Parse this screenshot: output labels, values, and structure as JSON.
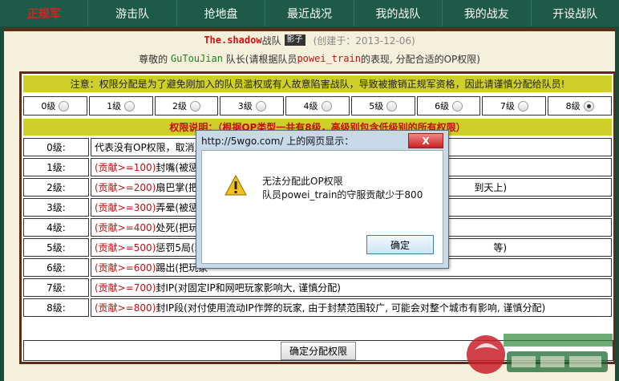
{
  "nav": {
    "items": [
      {
        "label": "正规军",
        "active": true
      },
      {
        "label": "游击队",
        "active": false
      },
      {
        "label": "抢地盘",
        "active": false
      },
      {
        "label": "最近战况",
        "active": false
      },
      {
        "label": "我的战队",
        "active": false
      },
      {
        "label": "我的战友",
        "active": false
      },
      {
        "label": "开设战队",
        "active": false
      }
    ]
  },
  "team": {
    "name": "The.shadow",
    "suffix": "战队",
    "logo_text": "影子",
    "created": "(创建于：2013-12-06)"
  },
  "subline": {
    "prefix": "尊敬的",
    "leader": "GuTouJian",
    "role": "队长(请根据队员",
    "member": "powei_train",
    "suffix": "的表现, 分配合适的OP权限)"
  },
  "notice": "注意：权限分配是为了避免刚加入的队员滥权或有人故意陷害战队，导致被撤销正规军资格，因此请谨慎分配给队员!",
  "levels": [
    {
      "label": "0级",
      "selected": false
    },
    {
      "label": "1级",
      "selected": false
    },
    {
      "label": "2级",
      "selected": false
    },
    {
      "label": "3级",
      "selected": false
    },
    {
      "label": "4级",
      "selected": false
    },
    {
      "label": "5级",
      "selected": false
    },
    {
      "label": "6级",
      "selected": false
    },
    {
      "label": "7级",
      "selected": false
    },
    {
      "label": "8级",
      "selected": true
    }
  ],
  "explain_title": "权限说明：（根据OP类型一共有8级，高级别包含低级别的所有权限）",
  "rows": [
    {
      "level": "0级:",
      "cond": "",
      "desc": "代表没有OP权限，取消此",
      "tail": ""
    },
    {
      "level": "1级:",
      "cond": "(贡献>=100)",
      "desc": "封嘴(被惩罚",
      "tail": ""
    },
    {
      "level": "2级:",
      "cond": "(贡献>=200)",
      "desc": "扇巴掌(把玩",
      "tail": "到天上)"
    },
    {
      "level": "3级:",
      "cond": "(贡献>=300)",
      "desc": "弄晕(被惩罚",
      "tail": ""
    },
    {
      "level": "4级:",
      "cond": "(贡献>=400)",
      "desc": "处死(把玩家",
      "tail": ""
    },
    {
      "level": "5级:",
      "cond": "(贡献>=500)",
      "desc": "惩罚5局(玩家",
      "tail": "等)"
    },
    {
      "level": "6级:",
      "cond": "(贡献>=600)",
      "desc": "踢出(把玩家",
      "tail": ""
    },
    {
      "level": "7级:",
      "cond": "(贡献>=700)",
      "desc": "封IP(对固定IP和网吧玩家影响大, 谨慎分配)",
      "tail": ""
    },
    {
      "level": "8级:",
      "cond": "(贡献>=800)",
      "desc": "封IP段(对付使用流动IP作弊的玩家, 由于封禁范围较广, 可能会对整个城市有影响, 谨慎分配)",
      "tail": ""
    }
  ],
  "assign_button": "确定分配权限",
  "dialog": {
    "title": "http://5wgo.com/ 上的网页显示：",
    "close": "X",
    "line1": "无法分配此OP权限",
    "line2": "队员powei_train的守服贡献少于800",
    "ok": "确定"
  }
}
